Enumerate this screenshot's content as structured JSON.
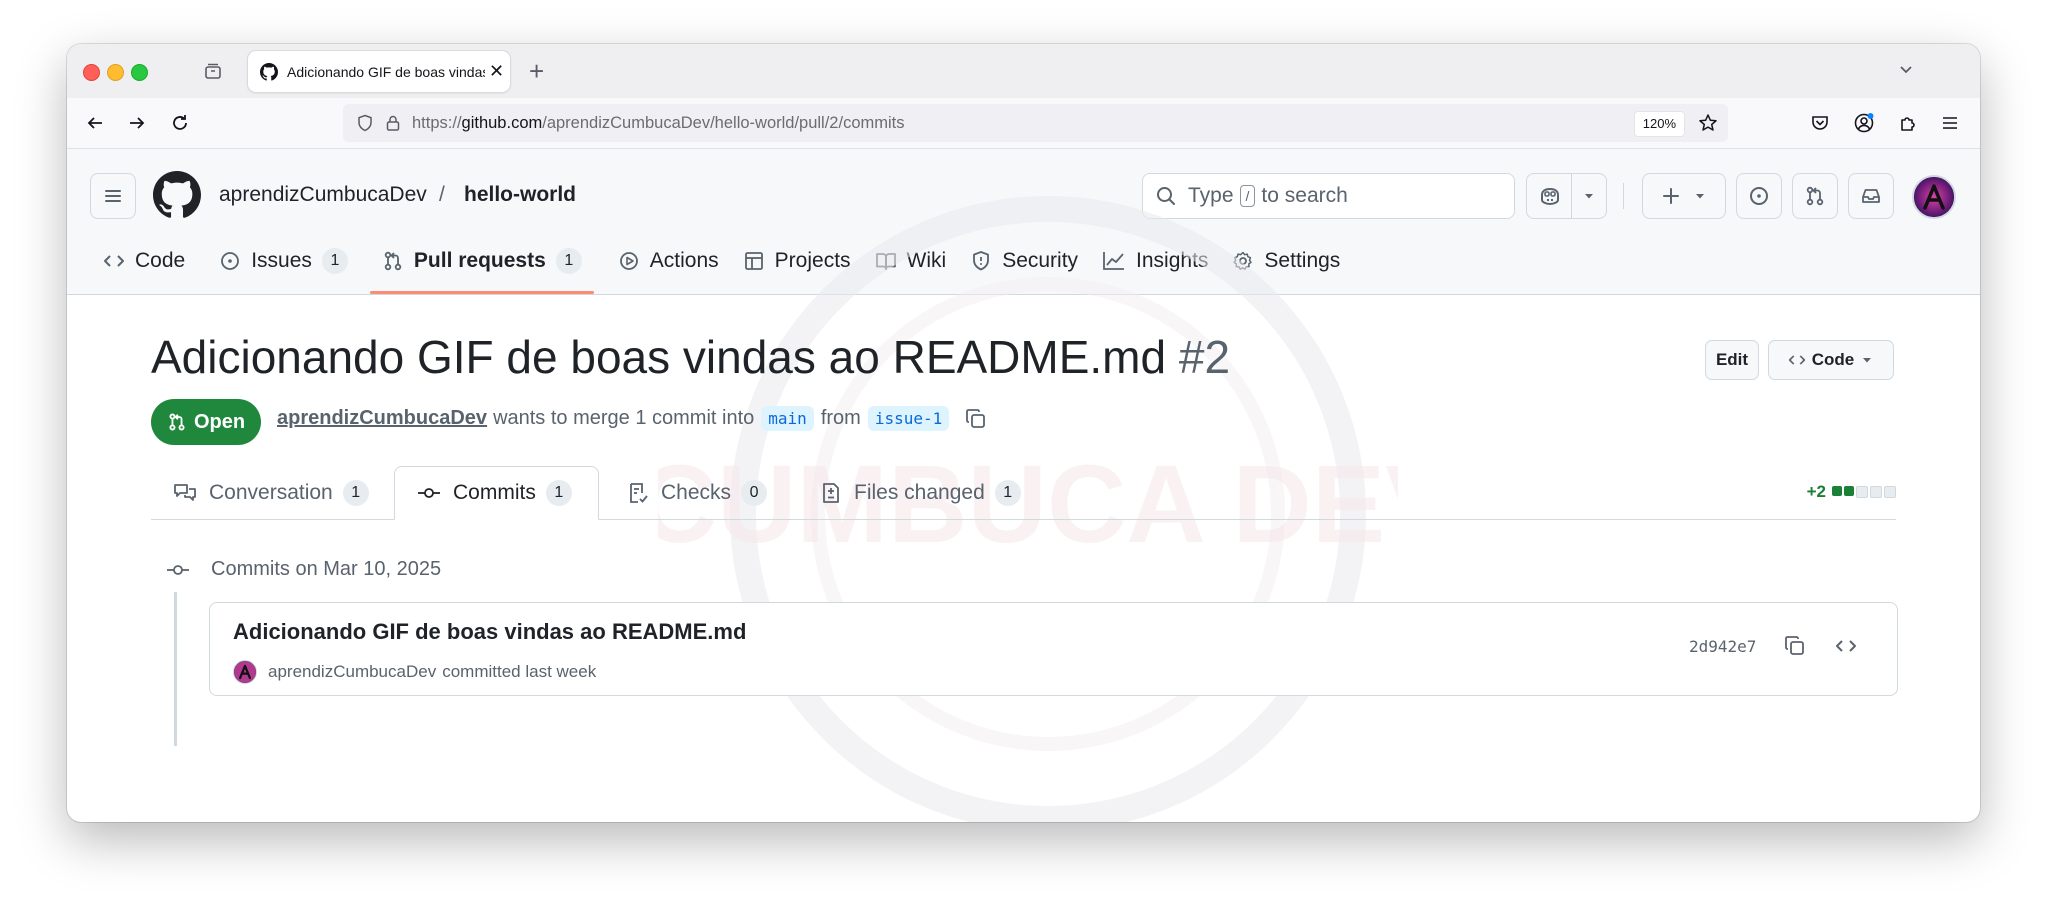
{
  "browser": {
    "tab_title": "Adicionando GIF de boas vindas",
    "url_scheme": "https://",
    "url_host": "github.com",
    "url_path": "/aprendizCumbucaDev/hello-world/pull/2/commits",
    "zoom": "120%"
  },
  "header": {
    "owner": "aprendizCumbucaDev",
    "separator": "/",
    "repo": "hello-world",
    "search_prefix": "Type",
    "search_key": "/",
    "search_suffix": "to search"
  },
  "repo_nav": [
    {
      "label": "Code",
      "icon": "code-icon"
    },
    {
      "label": "Issues",
      "icon": "issue-icon",
      "count": "1"
    },
    {
      "label": "Pull requests",
      "icon": "pull-request-icon",
      "count": "1",
      "selected": true
    },
    {
      "label": "Actions",
      "icon": "play-icon"
    },
    {
      "label": "Projects",
      "icon": "table-icon"
    },
    {
      "label": "Wiki",
      "icon": "book-icon"
    },
    {
      "label": "Security",
      "icon": "shield-icon"
    },
    {
      "label": "Insights",
      "icon": "graph-icon"
    },
    {
      "label": "Settings",
      "icon": "gear-icon"
    }
  ],
  "pr": {
    "title": "Adicionando GIF de boas vindas ao README.md",
    "number": "#2",
    "edit_label": "Edit",
    "code_label": "Code",
    "state": "Open",
    "author": "aprendizCumbucaDev",
    "merge_text": "wants to merge 1 commit into",
    "base_branch": "main",
    "from_text": "from",
    "head_branch": "issue-1"
  },
  "pr_tabs": [
    {
      "label": "Conversation",
      "count": "1",
      "icon": "comment-discussion-icon"
    },
    {
      "label": "Commits",
      "count": "1",
      "icon": "git-commit-icon",
      "active": true
    },
    {
      "label": "Checks",
      "count": "0",
      "icon": "checklist-icon"
    },
    {
      "label": "Files changed",
      "count": "1",
      "icon": "file-diff-icon"
    }
  ],
  "diffstat": {
    "additions": "+2",
    "green_blocks": 2,
    "total_blocks": 5
  },
  "commits": {
    "group_label": "Commits on Mar 10, 2025",
    "items": [
      {
        "title": "Adicionando GIF de boas vindas ao README.md",
        "author": "aprendizCumbucaDev",
        "when": "committed last week",
        "sha": "2d942e7"
      }
    ]
  },
  "watermark_text": "CUMBUCA DEV",
  "colors": {
    "open_green": "#1f883d",
    "selected_underline": "#fd8c73",
    "link_blue": "#0969da",
    "diff_green": "#1a7f37"
  }
}
